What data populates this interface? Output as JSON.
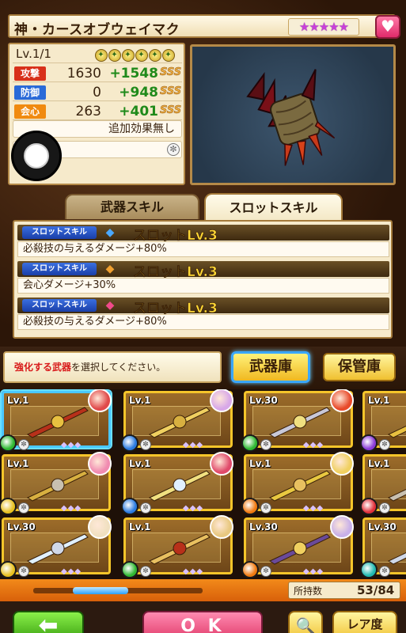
{
  "detail": {
    "name": "神・カースオブウェイマク",
    "rarity": "★★★★★",
    "favorite_icon": "heart-icon",
    "level": "Lv.1/1",
    "stats": [
      {
        "label": "攻撃",
        "base": "1630",
        "bonus": "+1548",
        "grade": "SSS",
        "color": "#d8301a"
      },
      {
        "label": "防御",
        "base": "0",
        "bonus": "+948",
        "grade": "SSS",
        "color": "#2a6ad8"
      },
      {
        "label": "会心",
        "base": "263",
        "bonus": "+401",
        "grade": "SSS",
        "color": "#f08a10"
      }
    ],
    "extra_effect": "追加効果無し"
  },
  "tabs": {
    "weapon_skill": "武器スキル",
    "slot_skill": "スロットスキル"
  },
  "skills": [
    {
      "tag": "スロットスキル",
      "title": "スロットLv.3",
      "desc": "必殺技の与えるダメージ+80%"
    },
    {
      "tag": "スロットスキル",
      "title": "スロットLv.3",
      "desc": "会心ダメージ+30%"
    },
    {
      "tag": "スロットスキル",
      "title": "スロットLv.3",
      "desc": "必殺技の与えるダメージ+80%"
    }
  ],
  "instruction": {
    "highlight": "強化する武器",
    "rest": "を選択してください。"
  },
  "buttons": {
    "armory": "武器庫",
    "storage": "保管庫",
    "back": "⬅",
    "ok": "O K",
    "search": "🔍",
    "rarity_sort": "レア度"
  },
  "grid": [
    {
      "lv": "Lv.1",
      "element": "green",
      "selected": true
    },
    {
      "lv": "Lv.1",
      "element": "blue"
    },
    {
      "lv": "Lv.30",
      "element": "green"
    },
    {
      "lv": "Lv.1",
      "element": "purple"
    },
    {
      "lv": "Lv.1",
      "element": "yellow"
    },
    {
      "lv": "Lv.1",
      "element": "blue"
    },
    {
      "lv": "Lv.1",
      "element": "orange"
    },
    {
      "lv": "Lv.1",
      "element": "red"
    },
    {
      "lv": "Lv.30",
      "element": "yellow"
    },
    {
      "lv": "Lv.1",
      "element": "green"
    },
    {
      "lv": "Lv.30",
      "element": "orange"
    },
    {
      "lv": "Lv.30",
      "element": "teal"
    }
  ],
  "inventory": {
    "label": "所持数",
    "count": "53/84"
  },
  "colors": {
    "gold_border": "#f5c52a",
    "ok_pink": "#e03a6a",
    "back_green": "#3aa010",
    "count_orange": "#f28a1a"
  }
}
